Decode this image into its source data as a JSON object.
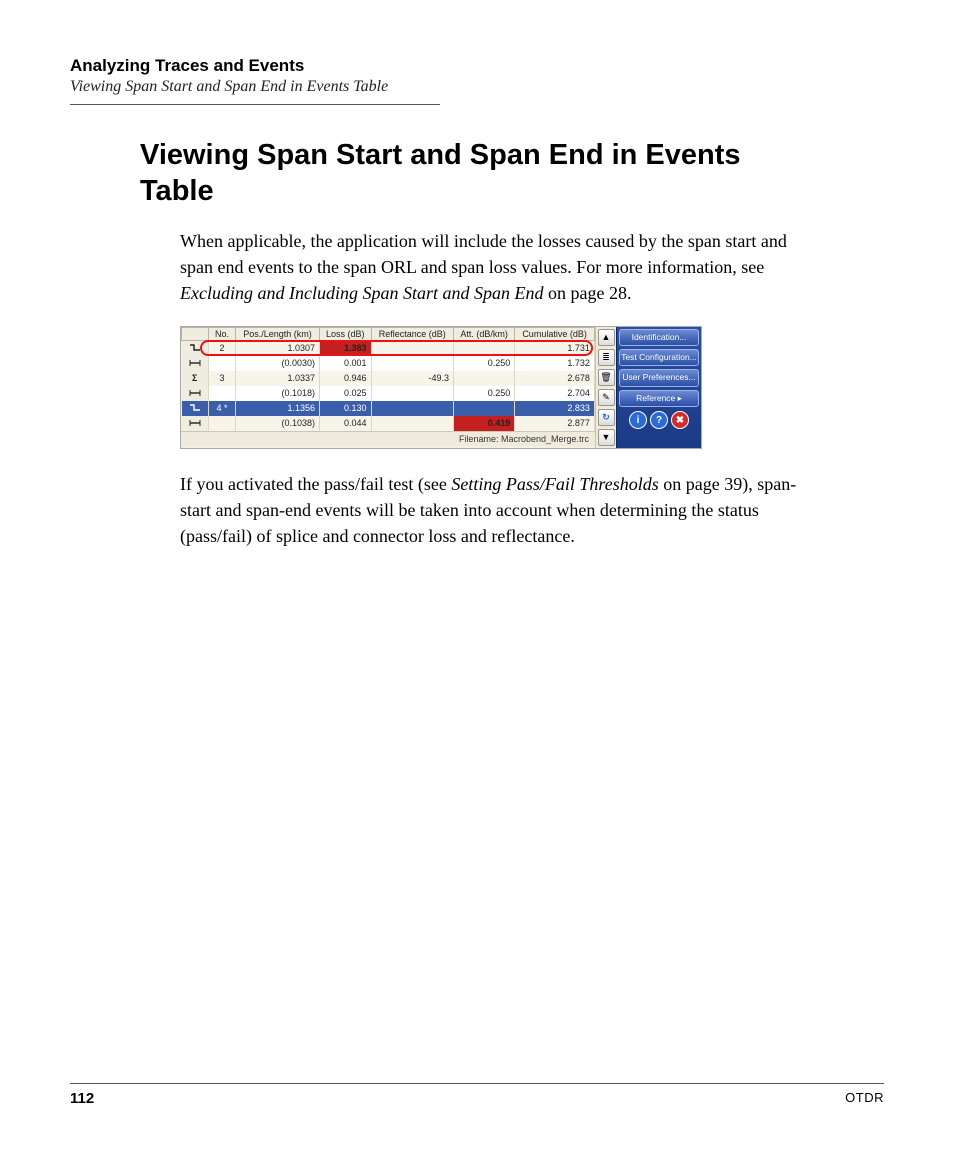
{
  "chapter": "Analyzing Traces and Events",
  "running_sub": "Viewing Span Start and Span End in Events Table",
  "heading": "Viewing Span Start and Span End in Events Table",
  "para1_a": "When applicable, the application will include the losses caused by the span start and span end events to the span ORL and span loss values. For more information, see ",
  "para1_i": "Excluding and Including Span Start and Span End",
  "para1_b": " on page 28.",
  "para2_a": "If you activated the pass/fail test (see ",
  "para2_i": "Setting Pass/Fail Thresholds",
  "para2_b": " on page 39), span-start and span-end events will be taken into account when determining the status (pass/fail) of splice and connector loss and reflectance.",
  "table": {
    "headers": [
      "No.",
      "Pos./Length (km)",
      "Loss (dB)",
      "Reflectance (dB)",
      "Att. (dB/km)",
      "Cumulative (dB)"
    ],
    "rows": [
      {
        "icon": "splice",
        "no": "2",
        "pos": "1.0307",
        "loss": "1.383",
        "loss_fail": true,
        "refl": "",
        "att": "",
        "cum": "1.731",
        "highlightRow": true
      },
      {
        "icon": "section",
        "no": "",
        "pos": "(0.0030)",
        "loss": "0.001",
        "refl": "",
        "att": "0.250",
        "cum": "1.732"
      },
      {
        "icon": "sigma",
        "no": "3",
        "pos": "1.0337",
        "loss": "0.946",
        "refl": "-49.3",
        "att": "",
        "cum": "2.678"
      },
      {
        "icon": "section",
        "no": "",
        "pos": "(0.1018)",
        "loss": "0.025",
        "refl": "",
        "att": "0.250",
        "cum": "2.704"
      },
      {
        "icon": "splice",
        "no": "4 *",
        "pos": "1.1356",
        "loss": "0.130",
        "refl": "",
        "att": "",
        "cum": "2.833",
        "selected": true
      },
      {
        "icon": "section",
        "no": "",
        "pos": "(0.1038)",
        "loss": "0.044",
        "refl": "",
        "att": "0.419",
        "att_fail": true,
        "cum": "2.877"
      }
    ],
    "filename": "Filename: Macrobend_Merge.trc"
  },
  "tools": {
    "up": "▲",
    "detail": "≣",
    "trash": "🗑",
    "edit": "✎",
    "refresh": "↻",
    "down": "▼"
  },
  "side": {
    "b1": "Identification...",
    "b2": "Test Configuration...",
    "b3": "User Preferences...",
    "b4": "Reference  ▸",
    "i1": "i",
    "i2": "?",
    "i3": "✖"
  },
  "footer": {
    "page": "112",
    "label": "OTDR"
  }
}
